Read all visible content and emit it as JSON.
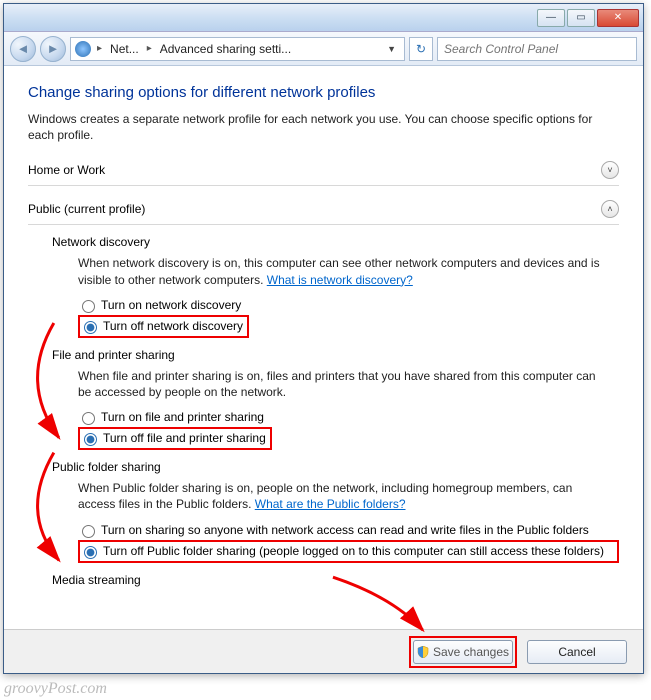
{
  "titlebar": {
    "min": "—",
    "max": "▭",
    "close": "✕"
  },
  "nav": {
    "back": "◄",
    "fwd": "►",
    "crumb1": "Net...",
    "crumb2": "Advanced sharing setti...",
    "dropdown": "▼",
    "refresh": "↻",
    "search_placeholder": "Search Control Panel"
  },
  "page": {
    "title": "Change sharing options for different network profiles",
    "intro": "Windows creates a separate network profile for each network you use. You can choose specific options for each profile."
  },
  "profiles": {
    "home": {
      "label": "Home or Work",
      "chev": "˅"
    },
    "public": {
      "label": "Public (current profile)",
      "chev": "˄"
    }
  },
  "sections": {
    "network_discovery": {
      "title": "Network discovery",
      "body_pre": "When network discovery is on, this computer can see other network computers and devices and is visible to other network computers. ",
      "link": "What is network discovery?",
      "opt_on": "Turn on network discovery",
      "opt_off": "Turn off network discovery"
    },
    "file_printer": {
      "title": "File and printer sharing",
      "body": "When file and printer sharing is on, files and printers that you have shared from this computer can be accessed by people on the network.",
      "opt_on": "Turn on file and printer sharing",
      "opt_off": "Turn off file and printer sharing"
    },
    "public_folder": {
      "title": "Public folder sharing",
      "body_pre": "When Public folder sharing is on, people on the network, including homegroup members, can access files in the Public folders. ",
      "link": "What are the Public folders?",
      "opt_on": "Turn on sharing so anyone with network access can read and write files in the Public folders",
      "opt_off": "Turn off Public folder sharing (people logged on to this computer can still access these folders)"
    },
    "media": {
      "title": "Media streaming"
    }
  },
  "footer": {
    "save": "Save changes",
    "cancel": "Cancel"
  },
  "watermark": "groovyPost.com"
}
